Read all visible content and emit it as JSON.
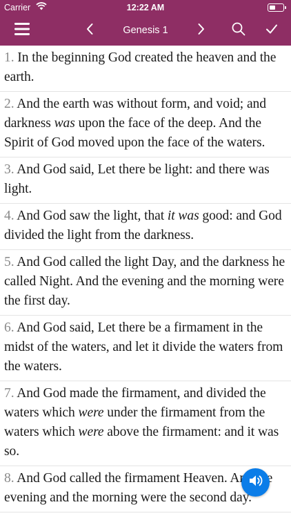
{
  "status_bar": {
    "carrier": "Carrier",
    "time": "12:22 AM"
  },
  "nav": {
    "title": "Genesis 1"
  },
  "colors": {
    "nav_bg": "#8e2e64",
    "audio_button": "#0b7de8"
  },
  "icons": [
    "menu-icon",
    "chevron-left-icon",
    "chevron-right-icon",
    "search-icon",
    "checkmark-icon",
    "speaker-icon"
  ],
  "verses": [
    {
      "num": "1.",
      "parts": [
        " In the beginning God created the heaven and the earth."
      ]
    },
    {
      "num": "2.",
      "parts": [
        " And the earth was without form, and void; and darkness ",
        "was",
        " upon the face of the deep. And the Spirit of God moved upon the face of the waters."
      ]
    },
    {
      "num": "3.",
      "parts": [
        " And God said, Let there be light: and there was light."
      ]
    },
    {
      "num": "4.",
      "parts": [
        " And God saw the light, that ",
        "it was",
        " good: and God divided the light from the darkness."
      ]
    },
    {
      "num": "5.",
      "parts": [
        " And God called the light Day, and the darkness he called Night. And the evening and the morning were the first day."
      ]
    },
    {
      "num": "6.",
      "parts": [
        " And God said, Let there be a firmament in the midst of the waters, and let it divide the waters from the waters."
      ]
    },
    {
      "num": "7.",
      "parts": [
        " And God made the firmament, and divided the waters which ",
        "were",
        " under the firmament from the waters which ",
        "were",
        " above the firmament: and it was so."
      ]
    },
    {
      "num": "8.",
      "parts": [
        " And God called the firmament Heaven. And the evening and the morning were the second day."
      ]
    }
  ]
}
